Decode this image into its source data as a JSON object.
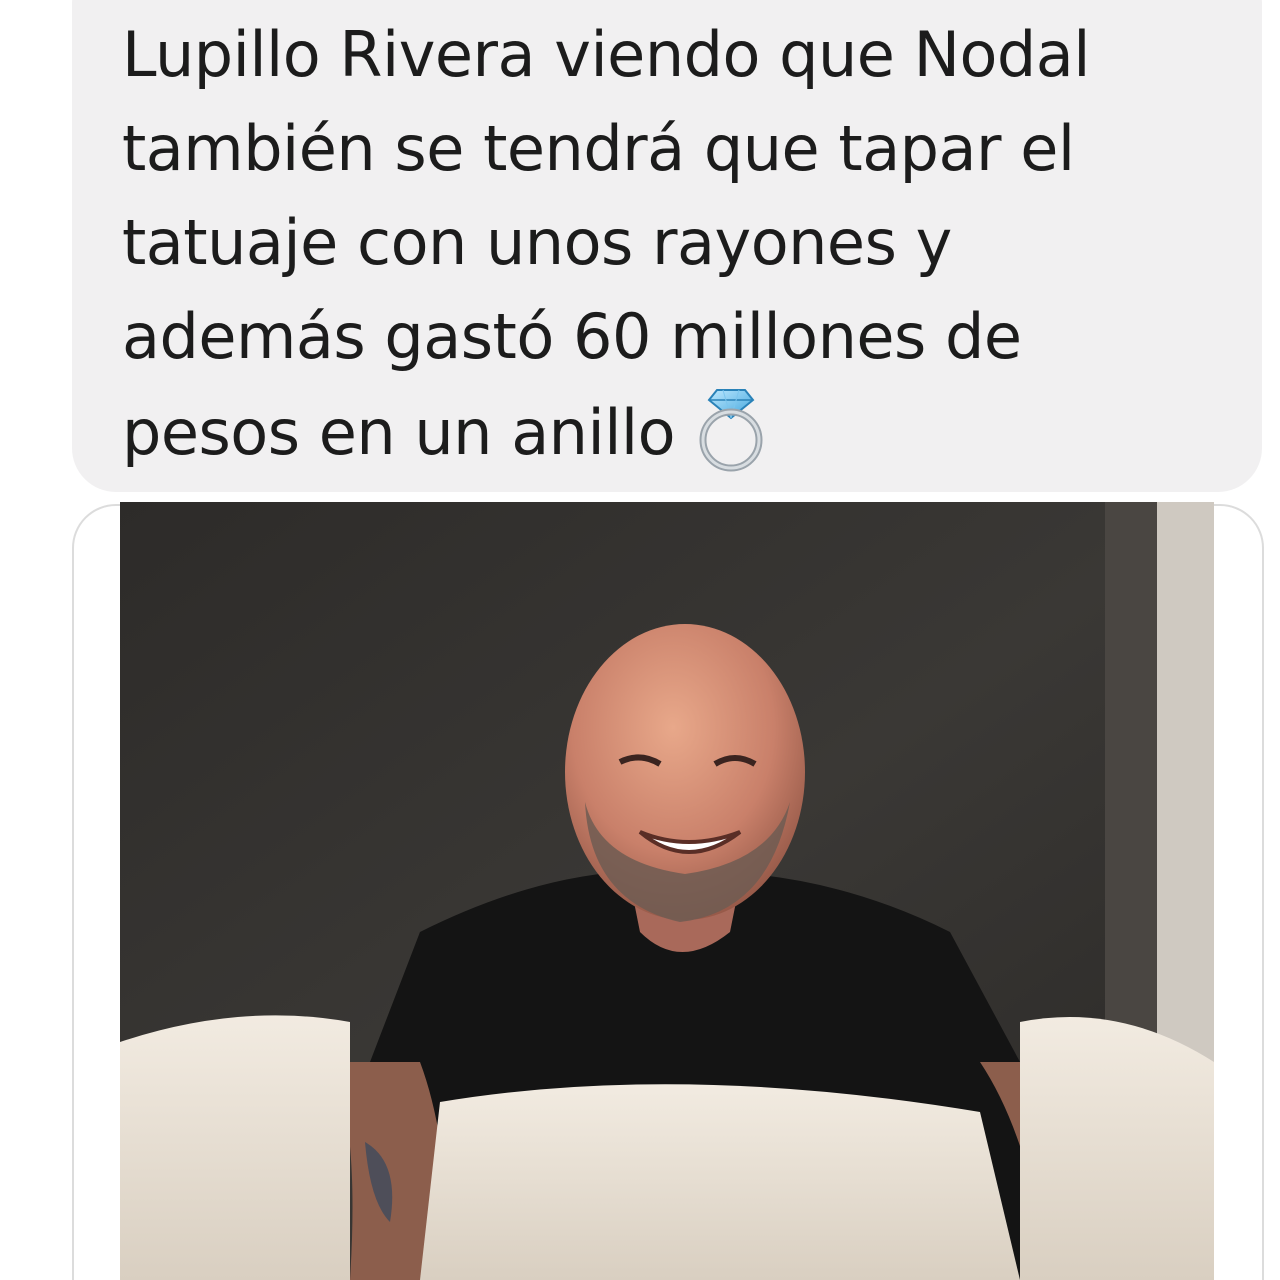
{
  "message": {
    "lines": [
      "Lupillo Rivera viendo que Nodal",
      "también se tendrá que tapar el",
      "tatuaje con unos rayones y",
      "además gastó 60 millones de",
      "pesos en un anillo"
    ],
    "trailing_emoji": "ring-icon"
  },
  "attachment": {
    "type": "photo",
    "subject": "smiling bald man in black t-shirt under white bed covers"
  },
  "colors": {
    "bubble_background": "#f1f0f1",
    "text": "#1c1c1c",
    "frame_border": "#dcdcdc"
  }
}
